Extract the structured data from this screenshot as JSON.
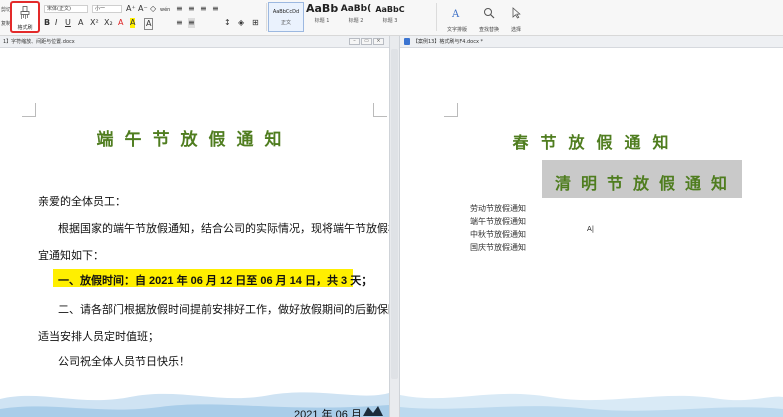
{
  "ribbon": {
    "clipboard_labels": [
      "剪切",
      "复制"
    ],
    "format_painter_label": "格式刷",
    "font_name": "宋体(正文)",
    "font_size": "小一",
    "font_buttons": [
      "A⁺",
      "A⁻",
      "◇",
      "wén"
    ],
    "format_buttons": [
      "B",
      "I",
      "U",
      "A",
      "X²",
      "X₂",
      "A",
      "A",
      "A"
    ],
    "para_buttons": [
      "≡",
      "≡",
      "≡",
      "≡",
      "≡",
      "≡",
      "↕",
      "◈",
      "⊞"
    ],
    "styles": [
      {
        "sample": "AaBbCcDd",
        "name": "正文"
      },
      {
        "sample": "AaBb",
        "name": "标题 1"
      },
      {
        "sample": "AaBb(",
        "name": "标题 2"
      },
      {
        "sample": "AaBbC",
        "name": "标题 3"
      }
    ],
    "text_tools_label": "文字排版",
    "find_replace_label": "查找替换",
    "select_label": "选择"
  },
  "left_pane": {
    "title": "1】字符缩放、间距与位置.docx",
    "doc": {
      "heading": "端午节放假通知",
      "greeting": "亲爱的全体员工：",
      "para1_line1": "根据国家的端午节放假通知，结合公司的实际情况，现将端午节放假相关事",
      "para1_line2": "宜通知如下：",
      "item1": "一、放假时间：自 2021 年 06 月 12 日至 06 月 14 日，共 3 天；",
      "item2_line1": "二、请各部门根据放假时间提前安排好工作，做好放假期间的后勤保障工作，",
      "item2_line2": "适当安排人员定时值班；",
      "closing": "公司祝全体人员节日快乐！",
      "date": "2021 年 06 月"
    }
  },
  "right_pane": {
    "title": "【案例13】格式刷与F4.docx *",
    "doc": {
      "heading1": "春节放假通知",
      "heading2": "清明节放假通知",
      "list": [
        "劳动节放假通知",
        "端午节放假通知",
        "中秋节放假通知",
        "国庆节放假通知"
      ],
      "cursor_mark": "A|"
    }
  },
  "colors": {
    "title_green": "#4f7d1f",
    "highlight_yellow": "#ffef00",
    "gray_band": "#c9c9c9",
    "painter_outline": "#e32a2a"
  }
}
